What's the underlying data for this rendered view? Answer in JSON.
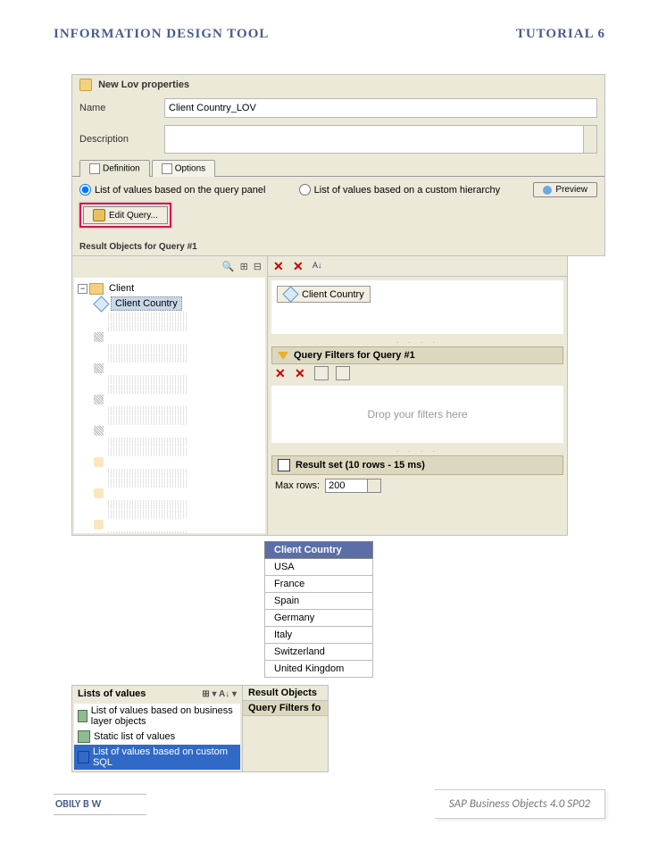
{
  "header": {
    "title": "INFORMATION DESIGN TOOL",
    "tutorial": "TUTORIAL 6"
  },
  "ss1": {
    "window_title": "New Lov properties",
    "name_label": "Name",
    "name_value": "Client Country_LOV",
    "desc_label": "Description",
    "tab_definition": "Definition",
    "tab_options": "Options",
    "radio_query": "List of values based on the query panel",
    "radio_hierarchy": "List of values based on a custom hierarchy",
    "preview_btn": "Preview",
    "edit_query_btn": "Edit Query...",
    "result_objects_hdr": "Result Objects for Query #1"
  },
  "ss2": {
    "tree_root": "Client",
    "tree_selected": "Client Country",
    "chip_label": "Client Country",
    "filters_header": "Query Filters for Query #1",
    "filters_placeholder": "Drop your filters here",
    "resultset_header": "Result set (10 rows - 15 ms)",
    "maxrows_label": "Max rows:",
    "maxrows_value": "200"
  },
  "result": {
    "column": "Client Country",
    "rows": [
      "USA",
      "France",
      "Spain",
      "Germany",
      "Italy",
      "Switzerland",
      "United Kingdom"
    ]
  },
  "ss3": {
    "panel_title": "Lists of values",
    "items": [
      "List of values based on business layer objects",
      "Static list of values",
      "List of values based on custom SQL"
    ],
    "right_hdr1": "Result Objects",
    "right_hdr2": "Query Filters fo"
  },
  "footer": {
    "author": "OBILY B W",
    "product": "SAP Business Objects 4.0 SP02"
  }
}
